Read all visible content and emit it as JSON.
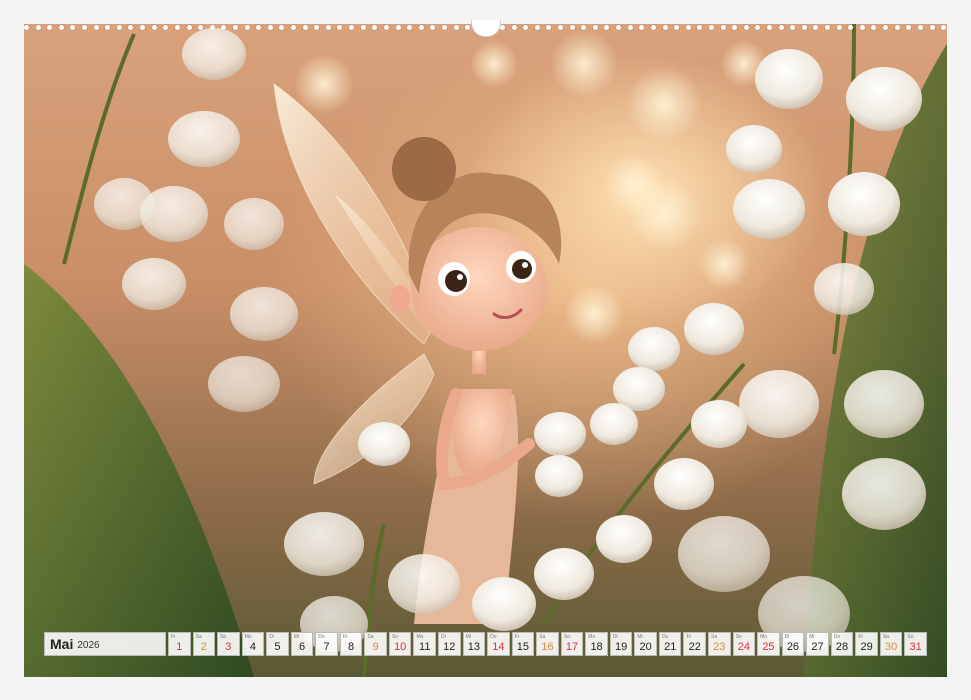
{
  "calendar": {
    "month": "Mai",
    "year": "2026",
    "days": [
      {
        "num": "1",
        "wd": "Fr",
        "type": "holiday"
      },
      {
        "num": "2",
        "wd": "Sa",
        "type": "weekend"
      },
      {
        "num": "3",
        "wd": "So",
        "type": "sunday"
      },
      {
        "num": "4",
        "wd": "Mo",
        "type": "weekday"
      },
      {
        "num": "5",
        "wd": "Di",
        "type": "weekday"
      },
      {
        "num": "6",
        "wd": "Mi",
        "type": "weekday"
      },
      {
        "num": "7",
        "wd": "Do",
        "type": "weekday"
      },
      {
        "num": "8",
        "wd": "Fr",
        "type": "weekday"
      },
      {
        "num": "9",
        "wd": "Sa",
        "type": "weekend"
      },
      {
        "num": "10",
        "wd": "So",
        "type": "sunday"
      },
      {
        "num": "11",
        "wd": "Mo",
        "type": "weekday"
      },
      {
        "num": "12",
        "wd": "Di",
        "type": "weekday"
      },
      {
        "num": "13",
        "wd": "Mi",
        "type": "weekday"
      },
      {
        "num": "14",
        "wd": "Do",
        "type": "holiday"
      },
      {
        "num": "15",
        "wd": "Fr",
        "type": "weekday"
      },
      {
        "num": "16",
        "wd": "Sa",
        "type": "weekend"
      },
      {
        "num": "17",
        "wd": "So",
        "type": "sunday"
      },
      {
        "num": "18",
        "wd": "Mo",
        "type": "weekday"
      },
      {
        "num": "19",
        "wd": "Di",
        "type": "weekday"
      },
      {
        "num": "20",
        "wd": "Mi",
        "type": "weekday"
      },
      {
        "num": "21",
        "wd": "Do",
        "type": "weekday"
      },
      {
        "num": "22",
        "wd": "Fr",
        "type": "weekday"
      },
      {
        "num": "23",
        "wd": "Sa",
        "type": "weekend"
      },
      {
        "num": "24",
        "wd": "So",
        "type": "sunday"
      },
      {
        "num": "25",
        "wd": "Mo",
        "type": "holiday"
      },
      {
        "num": "26",
        "wd": "Di",
        "type": "weekday"
      },
      {
        "num": "27",
        "wd": "Mi",
        "type": "weekday"
      },
      {
        "num": "28",
        "wd": "Do",
        "type": "weekday"
      },
      {
        "num": "29",
        "wd": "Fr",
        "type": "weekday"
      },
      {
        "num": "30",
        "wd": "Sa",
        "type": "weekend"
      },
      {
        "num": "31",
        "wd": "So",
        "type": "sunday"
      }
    ]
  },
  "photo": {
    "subject": "fairy-among-lily-of-the-valley"
  }
}
